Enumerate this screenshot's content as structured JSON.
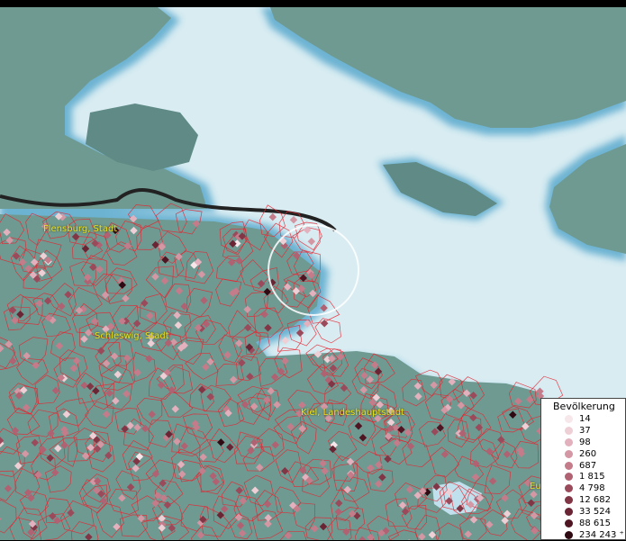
{
  "map": {
    "colors": {
      "land": "#6f9a92",
      "land_dark": "#5f8a85",
      "water": "#d8ecf2",
      "coast": "#4aa0c8",
      "boundary": "#e8232f",
      "border_line": "#222222",
      "highlight_circle": "#ffffff"
    },
    "cities": [
      {
        "name": "Flensburg, Stadt"
      },
      {
        "name": "Schleswig, Stadt"
      },
      {
        "name": "Kiel, Landeshauptstadt"
      },
      {
        "name": "Eu"
      }
    ]
  },
  "legend": {
    "title": "Bevölkerung",
    "items": [
      {
        "label": "14",
        "color": "#f7e6ea"
      },
      {
        "label": "37",
        "color": "#efcfd6"
      },
      {
        "label": "98",
        "color": "#e2b1bd"
      },
      {
        "label": "260",
        "color": "#d497a4"
      },
      {
        "label": "687",
        "color": "#c47c8b"
      },
      {
        "label": "1 815",
        "color": "#b06272"
      },
      {
        "label": "4 798",
        "color": "#9a4a5a"
      },
      {
        "label": "12 682",
        "color": "#823545"
      },
      {
        "label": "33 524",
        "color": "#6a2433"
      },
      {
        "label": "88 615",
        "color": "#4f1522"
      },
      {
        "label": "234 243 ⁺",
        "color": "#300a12"
      }
    ]
  }
}
